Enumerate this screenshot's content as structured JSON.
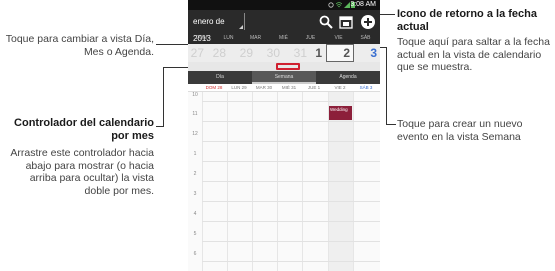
{
  "annotations": {
    "cambiar_vista": "Toque para cambiar a vista Día, Mes o Agenda.",
    "controlador_title": "Controlador del calendario por mes",
    "controlador_desc": "Arrastre este controlador hacia abajo para mostrar (o hacia arriba para ocultar) la vista doble por mes.",
    "icono_title": "Icono de retorno a la fecha actual",
    "icono_desc": "Toque aquí para saltar a la fecha actual en la vista de calendario que se muestra.",
    "crear_evento": "Toque para crear un nuevo evento en la vista Semana"
  },
  "phone": {
    "status_time": "3:08 AM",
    "month_selector": "enero de 2013",
    "day_names": [
      "DOM",
      "LUN",
      "MAR",
      "MIÉ",
      "JUE",
      "VIE",
      "SÁB"
    ],
    "week_dates": [
      "27",
      "28",
      "29",
      "30",
      "31",
      "1",
      "2",
      "3"
    ],
    "view_tabs": [
      "Día",
      "Semana",
      "Agenda"
    ],
    "selected_tab": "Semana",
    "column_headers": [
      "DOM 28",
      "LUN 29",
      "MAR 30",
      "MIÉ 31",
      "JUE 1",
      "VIE 2",
      "SÁB 3"
    ],
    "hours": [
      "10",
      "11",
      "12",
      "1",
      "2",
      "3",
      "4",
      "5",
      "6"
    ],
    "event_label": "Wedding",
    "colors": {
      "accent_red": "#d02030",
      "event": "#8c1f3a",
      "action_bar": "#2a2a2a",
      "saturday_blue": "#3a6fd0"
    },
    "icons": [
      "search-icon",
      "today-icon",
      "add-icon"
    ]
  }
}
